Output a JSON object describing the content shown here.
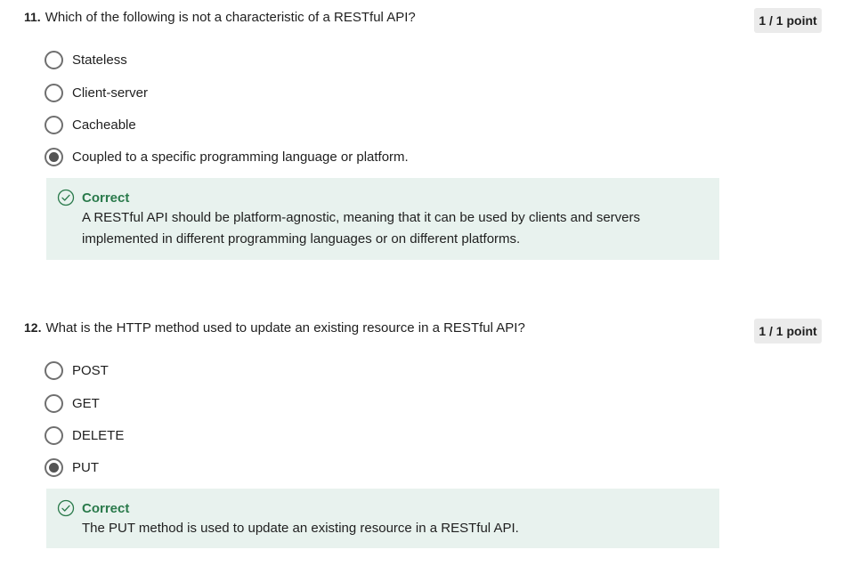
{
  "questions": [
    {
      "number": "11.",
      "text": "Which of the following is not a characteristic of a RESTful API?",
      "points": "1 / 1 point",
      "options": [
        {
          "label": "Stateless",
          "selected": false
        },
        {
          "label": "Client-server",
          "selected": false
        },
        {
          "label": "Cacheable",
          "selected": false
        },
        {
          "label": "Coupled to a specific programming language or platform.",
          "selected": true
        }
      ],
      "feedback": {
        "title": "Correct",
        "text": "A RESTful API should be platform-agnostic, meaning that it can be used by clients and servers implemented in different programming languages or on different platforms."
      }
    },
    {
      "number": "12.",
      "text": "What is the HTTP method used to update an existing resource in a RESTful API?",
      "points": "1 / 1 point",
      "options": [
        {
          "label": "POST",
          "selected": false
        },
        {
          "label": "GET",
          "selected": false
        },
        {
          "label": "DELETE",
          "selected": false
        },
        {
          "label": "PUT",
          "selected": true
        }
      ],
      "feedback": {
        "title": "Correct",
        "text": "The PUT method is used to update an existing resource in a RESTful API."
      }
    }
  ],
  "colors": {
    "correct_green": "#2a7a4b",
    "feedback_bg": "#e8f2ee",
    "badge_bg": "#ebebeb"
  },
  "icons": {
    "feedback": "check-circle-icon"
  }
}
